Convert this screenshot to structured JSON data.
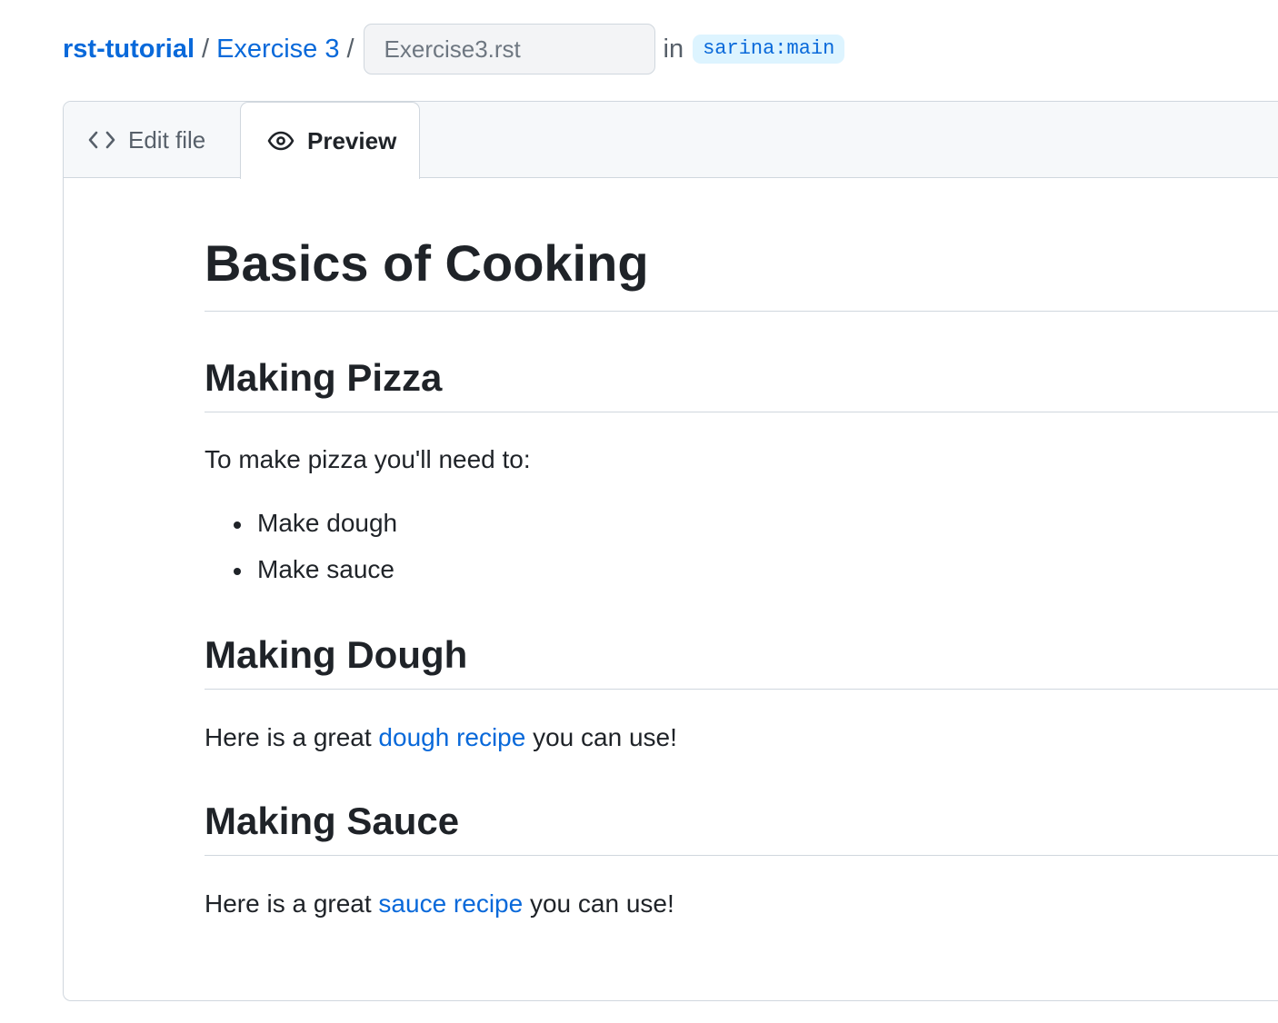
{
  "breadcrumb": {
    "repo": "rst-tutorial",
    "separator": "/",
    "folder": "Exercise 3",
    "filename_value": "",
    "filename_placeholder": "Exercise3.rst",
    "in_word": "in",
    "branch": "sarina:main"
  },
  "tabs": [
    {
      "label": "Edit file",
      "icon": "code-icon",
      "active": false
    },
    {
      "label": "Preview",
      "icon": "eye-icon",
      "active": true
    }
  ],
  "preview": {
    "title": "Basics of Cooking",
    "sections": [
      {
        "heading": "Making Pizza",
        "intro": "To make pizza you'll need to:",
        "bullets": [
          "Make dough",
          "Make sauce"
        ]
      },
      {
        "heading": "Making Dough",
        "text_before": "Here is a great ",
        "link": "dough recipe",
        "text_after": " you can use!"
      },
      {
        "heading": "Making Sauce",
        "text_before": "Here is a great ",
        "link": "sauce recipe",
        "text_after": " you can use!"
      }
    ]
  },
  "colors": {
    "link": "#0969da",
    "text": "#1f2328",
    "muted": "#57606a",
    "border": "#d0d7de",
    "tab_bar_bg": "#f6f8fa",
    "branch_bg": "#ddf4ff"
  }
}
